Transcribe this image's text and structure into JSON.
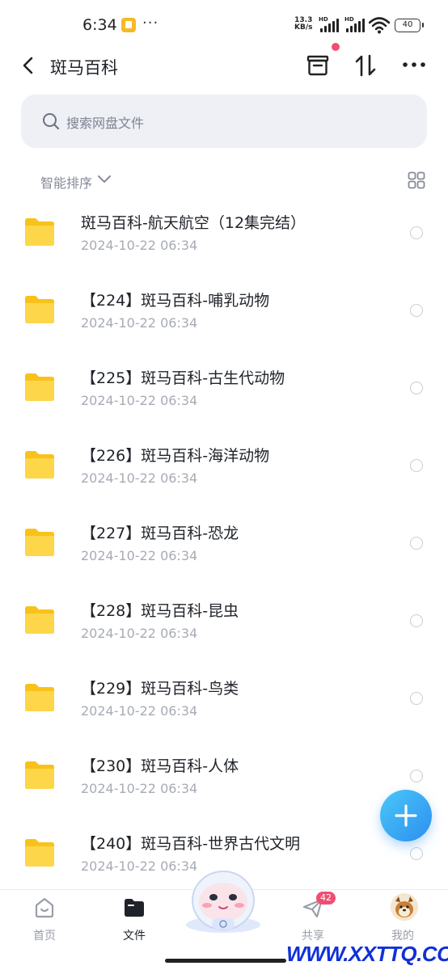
{
  "status_bar": {
    "time": "6:34",
    "more": "···",
    "net_speed_value": "13.3",
    "net_speed_unit": "KB/s",
    "hd1": "HD",
    "hd2": "HD",
    "battery": "40"
  },
  "header": {
    "title": "斑马百科",
    "icons": [
      "back-icon",
      "archive-icon",
      "sort-icon",
      "more-icon"
    ]
  },
  "search": {
    "placeholder": "搜索网盘文件"
  },
  "sort": {
    "label": "智能排序"
  },
  "files": [
    {
      "name": "斑马百科-航天航空（12集完结）",
      "date": "2024-10-22   06:34"
    },
    {
      "name": "【224】斑马百科-哺乳动物",
      "date": "2024-10-22   06:34"
    },
    {
      "name": "【225】斑马百科-古生代动物",
      "date": "2024-10-22   06:34"
    },
    {
      "name": "【226】斑马百科-海洋动物",
      "date": "2024-10-22   06:34"
    },
    {
      "name": "【227】斑马百科-恐龙",
      "date": "2024-10-22   06:34"
    },
    {
      "name": "【228】斑马百科-昆虫",
      "date": "2024-10-22   06:34"
    },
    {
      "name": "【229】斑马百科-鸟类",
      "date": "2024-10-22   06:34"
    },
    {
      "name": "【230】斑马百科-人体",
      "date": "2024-10-22   06:34"
    },
    {
      "name": "【240】斑马百科-世界古代文明",
      "date": "2024-10-22   06:34"
    }
  ],
  "bottom_nav": {
    "home": "首页",
    "files": "文件",
    "share": "共享",
    "share_badge": "42",
    "me": "我的"
  },
  "watermark": "WWW.XXTTQ.COM",
  "colors": {
    "accent": "#2d8ff0",
    "folder": "#fcd34d",
    "badge": "#f04e70",
    "watermark": "#1030d8"
  }
}
